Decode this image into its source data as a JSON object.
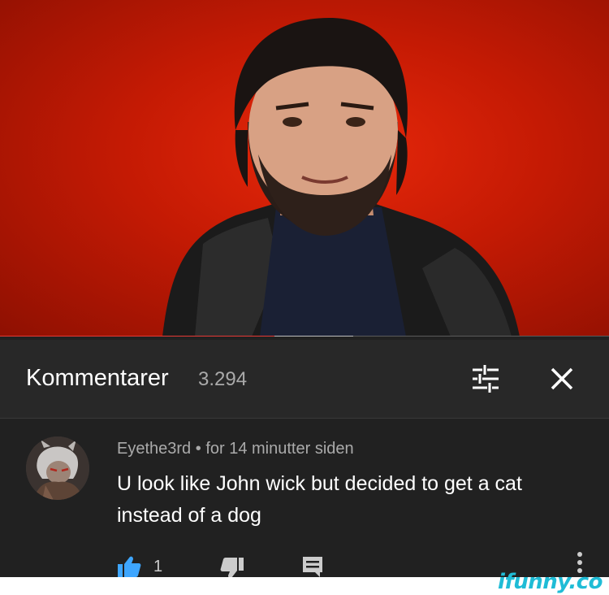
{
  "video": {
    "thumbnail": "man-in-leather-jacket-on-red-background",
    "progress_percent": 45,
    "buffered_percent": 58,
    "colors": {
      "background": "#d42008",
      "progress": "#e53935",
      "buffer": "#bdbdbd"
    }
  },
  "comments_panel": {
    "title": "Kommentarer",
    "count": "3.294",
    "filter_icon": "sort-filter-icon",
    "close_icon": "close-icon"
  },
  "comments": [
    {
      "avatar": "anime-character-avatar",
      "author": "Eyethe3rd",
      "separator": "•",
      "time": "for 14 minutter siden",
      "text_line_1": "U look like John wick but decided to get a cat",
      "text_line_2": "instead of a dog",
      "likes": "1",
      "like_icon": "thumbs-up-icon",
      "dislike_icon": "thumbs-down-icon",
      "reply_icon": "reply-icon",
      "more_icon": "more-vertical-icon"
    }
  ],
  "watermark": "ifunny.co"
}
